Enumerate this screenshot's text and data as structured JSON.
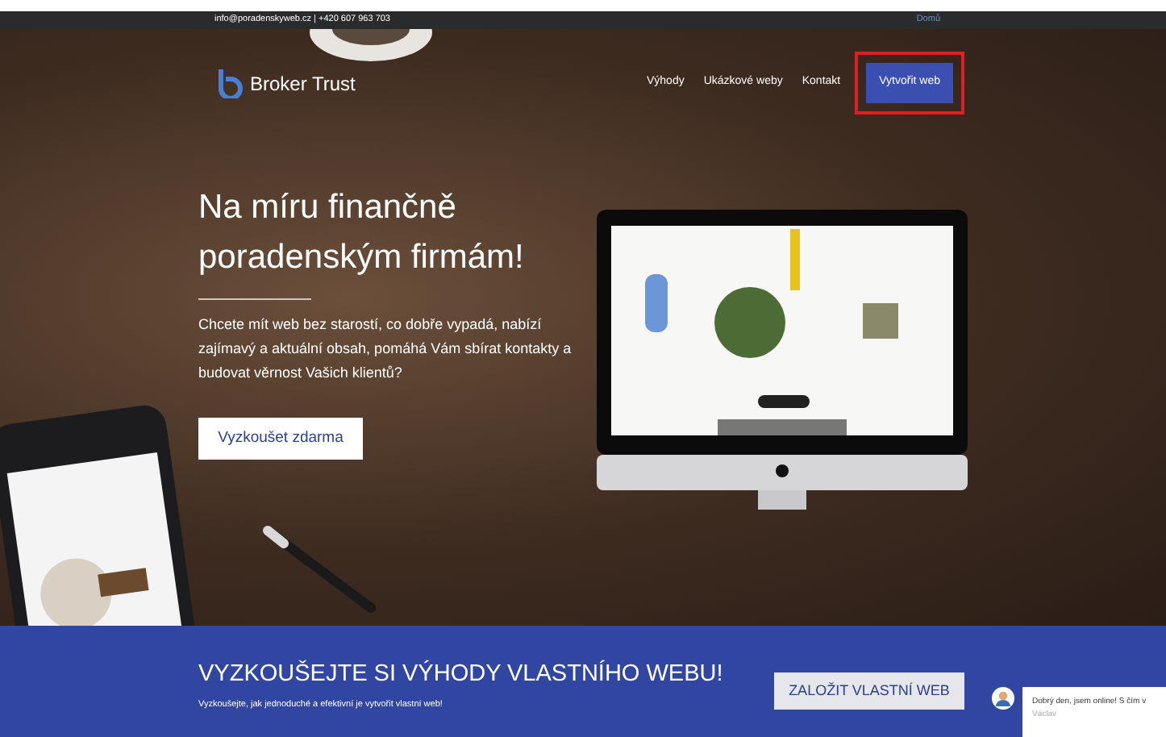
{
  "top_bar": {
    "contact": "info@poradenskyweb.cz | +420 607 963 703",
    "home_link": "Domů"
  },
  "header": {
    "logo_text": "Broker Trust",
    "nav": [
      {
        "label": "Výhody",
        "kind": "link",
        "highlighted": false
      },
      {
        "label": "Ukázkové weby",
        "kind": "link",
        "highlighted": false
      },
      {
        "label": "Kontakt",
        "kind": "link",
        "highlighted": false
      },
      {
        "label": "Vytvořit web",
        "kind": "button",
        "highlighted": true
      }
    ]
  },
  "hero": {
    "heading_lines": [
      "Na míru finančně",
      "poradenským firmám!"
    ],
    "text": "Chcete mít web bez starostí, co dobře vypadá, nabízí zajímavý a aktuální obsah, pomáhá Vám sbírat kontakty a budovat věrnost Vašich klientů?",
    "button": "Vyzkoušet zdarma"
  },
  "cta_band": {
    "heading": "VYZKOUŠEJTE SI VÝHODY VLASTNÍHO WEBU!",
    "text": "Vyzkoušejte, jak jednoduché a efektivní je vytvořit vlastní web!",
    "button": "ZALOŽIT VLASTNÍ WEB"
  },
  "chat": {
    "message": "Dobrý den, jsem online! S čím v",
    "author": "Václav"
  }
}
